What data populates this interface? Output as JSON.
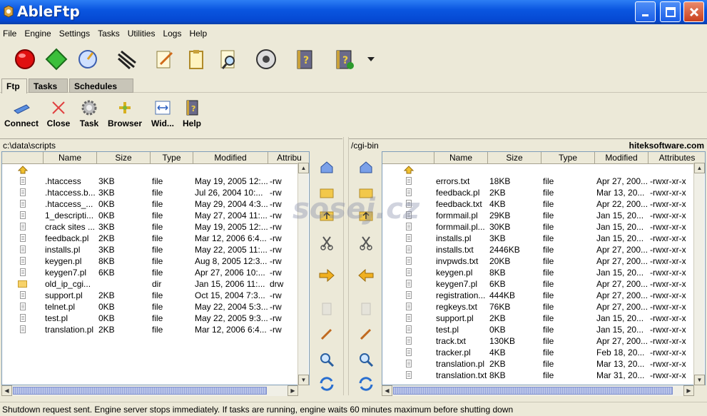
{
  "window": {
    "title": "AbleFtp"
  },
  "menu": [
    "File",
    "Engine",
    "Settings",
    "Tasks",
    "Utilities",
    "Logs",
    "Help"
  ],
  "toolbar_icons": [
    "stop-icon",
    "start-icon",
    "monitor-icon",
    "connections-icon",
    "edit-icon",
    "clipboard-icon",
    "search-doc-icon",
    "disk-icon",
    "help-book-icon",
    "help-book-add-icon",
    "dropdown-arrow-icon"
  ],
  "tabs": [
    "Ftp",
    "Tasks",
    "Schedules"
  ],
  "subtoolbar": [
    {
      "label": "Connect",
      "icon": "connect-icon"
    },
    {
      "label": "Close",
      "icon": "close-x-icon"
    },
    {
      "label": "Task",
      "icon": "task-gear-icon"
    },
    {
      "label": "Browser",
      "icon": "browser-icon"
    },
    {
      "label": "Wid...",
      "icon": "width-icon"
    },
    {
      "label": "Help",
      "icon": "help-book-icon"
    }
  ],
  "left": {
    "path": "c:\\data\\scripts",
    "columns": [
      "Name",
      "Size",
      "Type",
      "Modified",
      "Attribu"
    ],
    "rows": [
      {
        "type": "up",
        "name": "",
        "size": "",
        "kind": "",
        "modified": "",
        "attr": ""
      },
      {
        "type": "file",
        "name": ".htaccess",
        "size": "3KB",
        "kind": "file",
        "modified": "May 19, 2005 12:...",
        "attr": "-rw"
      },
      {
        "type": "file",
        "name": ".htaccess.b...",
        "size": "3KB",
        "kind": "file",
        "modified": "Jul 26, 2004 10:...",
        "attr": "-rw"
      },
      {
        "type": "file",
        "name": ".htaccess_...",
        "size": "0KB",
        "kind": "file",
        "modified": "May 29, 2004 4:3...",
        "attr": "-rw"
      },
      {
        "type": "file",
        "name": "1_descripti...",
        "size": "0KB",
        "kind": "file",
        "modified": "May 27, 2004 11:...",
        "attr": "-rw"
      },
      {
        "type": "file",
        "name": "crack sites ...",
        "size": "3KB",
        "kind": "file",
        "modified": "May 19, 2005 12:...",
        "attr": "-rw"
      },
      {
        "type": "file",
        "name": "feedback.pl",
        "size": "2KB",
        "kind": "file",
        "modified": "Mar 12, 2006 6:4...",
        "attr": "-rw"
      },
      {
        "type": "file",
        "name": "installs.pl",
        "size": "3KB",
        "kind": "file",
        "modified": "May 22, 2005 11:...",
        "attr": "-rw"
      },
      {
        "type": "file",
        "name": "keygen.pl",
        "size": "8KB",
        "kind": "file",
        "modified": "Aug 8, 2005 12:3...",
        "attr": "-rw"
      },
      {
        "type": "file",
        "name": "keygen7.pl",
        "size": "6KB",
        "kind": "file",
        "modified": "Apr 27, 2006 10:...",
        "attr": "-rw"
      },
      {
        "type": "dir",
        "name": "old_ip_cgi...",
        "size": "",
        "kind": "dir",
        "modified": "Jan 15, 2006 11:...",
        "attr": "drw"
      },
      {
        "type": "file",
        "name": "support.pl",
        "size": "2KB",
        "kind": "file",
        "modified": "Oct 15, 2004 7:3...",
        "attr": "-rw"
      },
      {
        "type": "file",
        "name": "telnet.pl",
        "size": "0KB",
        "kind": "file",
        "modified": "May 22, 2004 5:3...",
        "attr": "-rw"
      },
      {
        "type": "file",
        "name": "test.pl",
        "size": "0KB",
        "kind": "file",
        "modified": "May 22, 2005 9:3...",
        "attr": "-rw"
      },
      {
        "type": "file",
        "name": "translation.pl",
        "size": "2KB",
        "kind": "file",
        "modified": "Mar 12, 2006 6:4...",
        "attr": "-rw"
      }
    ]
  },
  "right": {
    "path": "/cgi-bin",
    "host": "hiteksoftware.com",
    "columns": [
      "Name",
      "Size",
      "Type",
      "Modified",
      "Attributes"
    ],
    "rows": [
      {
        "type": "up",
        "name": "",
        "size": "",
        "kind": "",
        "modified": "",
        "attr": ""
      },
      {
        "type": "file",
        "name": "errors.txt",
        "size": "18KB",
        "kind": "file",
        "modified": "Apr 27, 200...",
        "attr": "-rwxr-xr-x"
      },
      {
        "type": "file",
        "name": "feedback.pl",
        "size": "2KB",
        "kind": "file",
        "modified": "Mar 13, 20...",
        "attr": "-rwxr-xr-x"
      },
      {
        "type": "file",
        "name": "feedback.txt",
        "size": "4KB",
        "kind": "file",
        "modified": "Apr 22, 200...",
        "attr": "-rwxr-xr-x"
      },
      {
        "type": "file",
        "name": "formmail.pl",
        "size": "29KB",
        "kind": "file",
        "modified": "Jan 15, 20...",
        "attr": "-rwxr-xr-x"
      },
      {
        "type": "file",
        "name": "formmail.pl...",
        "size": "30KB",
        "kind": "file",
        "modified": "Jan 15, 20...",
        "attr": "-rwxr-xr-x"
      },
      {
        "type": "file",
        "name": "installs.pl",
        "size": "3KB",
        "kind": "file",
        "modified": "Jan 15, 20...",
        "attr": "-rwxr-xr-x"
      },
      {
        "type": "file",
        "name": "installs.txt",
        "size": "2446KB",
        "kind": "file",
        "modified": "Apr 27, 200...",
        "attr": "-rwxr-xr-x"
      },
      {
        "type": "file",
        "name": "invpwds.txt",
        "size": "20KB",
        "kind": "file",
        "modified": "Apr 27, 200...",
        "attr": "-rwxr-xr-x"
      },
      {
        "type": "file",
        "name": "keygen.pl",
        "size": "8KB",
        "kind": "file",
        "modified": "Jan 15, 20...",
        "attr": "-rwxr-xr-x"
      },
      {
        "type": "file",
        "name": "keygen7.pl",
        "size": "6KB",
        "kind": "file",
        "modified": "Apr 27, 200...",
        "attr": "-rwxr-xr-x"
      },
      {
        "type": "file",
        "name": "registration...",
        "size": "444KB",
        "kind": "file",
        "modified": "Apr 27, 200...",
        "attr": "-rwxr-xr-x"
      },
      {
        "type": "file",
        "name": "regkeys.txt",
        "size": "76KB",
        "kind": "file",
        "modified": "Apr 27, 200...",
        "attr": "-rwxr-xr-x"
      },
      {
        "type": "file",
        "name": "support.pl",
        "size": "2KB",
        "kind": "file",
        "modified": "Jan 15, 20...",
        "attr": "-rwxr-xr-x"
      },
      {
        "type": "file",
        "name": "test.pl",
        "size": "0KB",
        "kind": "file",
        "modified": "Jan 15, 20...",
        "attr": "-rwxr-xr-x"
      },
      {
        "type": "file",
        "name": "track.txt",
        "size": "130KB",
        "kind": "file",
        "modified": "Apr 27, 200...",
        "attr": "-rwxr-xr-x"
      },
      {
        "type": "file",
        "name": "tracker.pl",
        "size": "4KB",
        "kind": "file",
        "modified": "Feb 18, 20...",
        "attr": "-rwxr-xr-x"
      },
      {
        "type": "file",
        "name": "translation.pl",
        "size": "2KB",
        "kind": "file",
        "modified": "Mar 13, 20...",
        "attr": "-rwxr-xr-x"
      },
      {
        "type": "file",
        "name": "translation.txt",
        "size": "8KB",
        "kind": "file",
        "modified": "Mar 31, 20...",
        "attr": "-rwxr-xr-x"
      }
    ]
  },
  "transfer_icons": [
    "home-icon",
    "folder-icon",
    "folder-up-icon",
    "cut-icon",
    "transfer-arrow-icon",
    "delete-icon",
    "rename-pen-icon",
    "find-icon",
    "refresh-icon"
  ],
  "watermark": "sosej.cz",
  "status": "Shutdown request sent. Engine server stops immediately. If tasks are running, engine waits 60 minutes maximum before shutting down"
}
